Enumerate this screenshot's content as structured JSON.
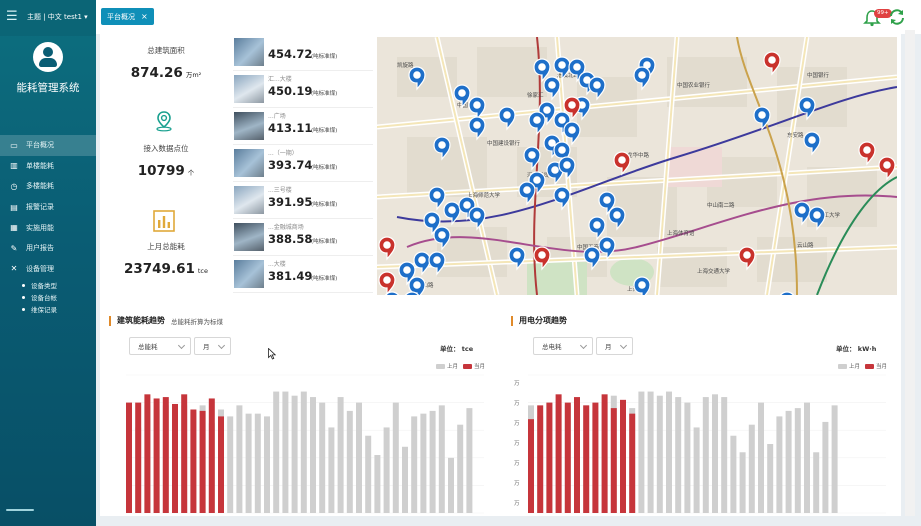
{
  "header": {
    "lang_user": "主题 | 中文  test1 ▾",
    "tab_label": "平台概况",
    "tab_close": "×",
    "notification_count": "99+"
  },
  "sidebar": {
    "system_title": "能耗管理系统",
    "items": [
      {
        "label": "平台概况",
        "icon": "monitor-icon",
        "active": true
      },
      {
        "label": "单楼能耗",
        "icon": "building-icon"
      },
      {
        "label": "多楼能耗",
        "icon": "clock-icon"
      },
      {
        "label": "报警记录",
        "icon": "document-icon"
      },
      {
        "label": "实施用能",
        "icon": "chart-icon"
      },
      {
        "label": "用户报告",
        "icon": "edit-icon"
      },
      {
        "label": "设备管理",
        "icon": "tools-icon"
      }
    ],
    "sub_items": [
      "设备类型",
      "设备台帐",
      "维保记录"
    ]
  },
  "summary": {
    "total_area_label": "总建筑面积",
    "total_area_value": "874.26",
    "total_area_unit": "万m²",
    "data_points_label": "接入数据点位",
    "data_points_value": "10799",
    "data_points_unit": "个",
    "last_month_label": "上月总能耗",
    "last_month_value": "23749.61",
    "last_month_unit": "tce"
  },
  "ranking": [
    {
      "name": "",
      "value": "454.72",
      "unit": "(吨标准煤)"
    },
    {
      "name": "汇...大楼",
      "value": "450.19",
      "unit": "(吨标准煤)"
    },
    {
      "name": "...广场",
      "value": "413.11",
      "unit": "(吨标准煤)"
    },
    {
      "name": "...（一期）",
      "value": "393.74",
      "unit": "(吨标准煤)"
    },
    {
      "name": "...三号楼",
      "value": "391.95",
      "unit": "(吨标准煤)"
    },
    {
      "name": "...金融城商场",
      "value": "388.58",
      "unit": "(吨标准煤)"
    },
    {
      "name": "...大楼",
      "value": "381.49",
      "unit": "(吨标准煤)"
    }
  ],
  "map": {
    "labels": [
      "中国建设银行",
      "中国工商银行",
      "中国银行",
      "中国农业银行",
      "东安路",
      "汇金百货",
      "上海体育馆",
      "上海南站",
      "华东理工大学",
      "上海交通大学",
      "中国电信",
      "徐家汇",
      "宜山路",
      "龙华中路",
      "漕溪北路",
      "中山南二路",
      "云山路",
      "上海师范大学",
      "凯旋路"
    ],
    "pin_color_normal": "#1e6fc9",
    "pin_color_alert": "#c9322c"
  },
  "charts": {
    "left": {
      "title": "建筑能耗趋势",
      "subtitle": "总能耗折算为标煤",
      "select1": "总能耗",
      "select2": "月",
      "unit": "单位：  tce",
      "legend_last": "上月",
      "legend_current": "当月"
    },
    "right": {
      "title": "用电分项趋势",
      "select1": "总电耗",
      "select2": "月",
      "unit": "单位：  kW·h",
      "legend_last": "上月",
      "legend_current": "当月",
      "axis_ticks": [
        "万",
        "万",
        "万",
        "万",
        "万",
        "万",
        "万"
      ]
    }
  },
  "chart_data": [
    {
      "type": "bar",
      "title": "建筑能耗趋势",
      "series": [
        {
          "name": "上月",
          "values": [
            0.78,
            0.62,
            0.78,
            0.75,
            0.78,
            0.7,
            0.78,
            0.73,
            0.78,
            0.65,
            0.75,
            0.7,
            0.78,
            0.72,
            0.72,
            0.7,
            0.88,
            0.88,
            0.85,
            0.88,
            0.84,
            0.8,
            0.62,
            0.84,
            0.74,
            0.8,
            0.56,
            0.42,
            0.62,
            0.8,
            0.48,
            0.7,
            0.72,
            0.74,
            0.78,
            0.4,
            0.64,
            0.76
          ]
        },
        {
          "name": "当月",
          "values": [
            0.8,
            0.8,
            0.86,
            0.83,
            0.84,
            0.79,
            0.86,
            0.75,
            0.74,
            0.83,
            0.7
          ]
        }
      ],
      "color_last": "#cfcfcf",
      "color_current": "#c6353b"
    },
    {
      "type": "bar",
      "title": "用电分项趋势",
      "series": [
        {
          "name": "上月",
          "values": [
            0.78,
            0.7,
            0.8,
            0.79,
            0.78,
            0.72,
            0.78,
            0.74,
            0.8,
            0.85,
            0.7,
            0.76,
            0.88,
            0.88,
            0.85,
            0.88,
            0.84,
            0.8,
            0.62,
            0.84,
            0.86,
            0.84,
            0.56,
            0.44,
            0.64,
            0.8,
            0.5,
            0.7,
            0.74,
            0.76,
            0.8,
            0.44,
            0.66,
            0.78
          ]
        },
        {
          "name": "当月",
          "values": [
            0.68,
            0.78,
            0.8,
            0.86,
            0.8,
            0.84,
            0.78,
            0.8,
            0.86,
            0.76,
            0.82,
            0.72
          ]
        }
      ],
      "color_last": "#cfcfcf",
      "color_current": "#c6353b"
    }
  ]
}
